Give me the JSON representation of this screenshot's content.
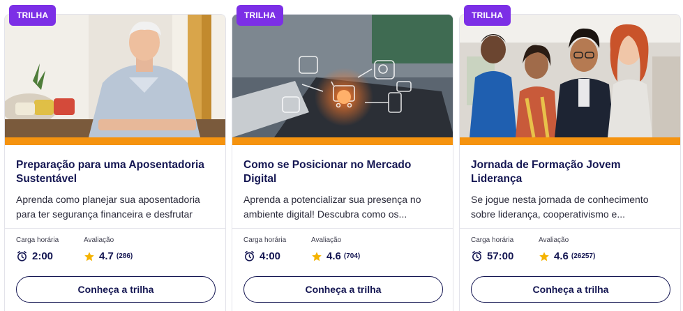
{
  "cards": [
    {
      "badge": "TRILHA",
      "title": "Preparação para uma Aposentadoria Sustentável",
      "description": "Aprenda como planejar sua aposentadoria para ter segurança financeira e desfrutar de...",
      "workload_label": "Carga horária",
      "workload": "2:00",
      "rating_label": "Avaliação",
      "rating": "4.7",
      "rating_count": "(286)",
      "cta": "Conheça a trilha"
    },
    {
      "badge": "TRILHA",
      "title": "Como se Posicionar no Mercado Digital",
      "description": "Aprenda a potencializar sua presença no ambiente digital! Descubra como os...",
      "workload_label": "Carga horária",
      "workload": "4:00",
      "rating_label": "Avaliação",
      "rating": "4.6",
      "rating_count": "(704)",
      "cta": "Conheça a trilha"
    },
    {
      "badge": "TRILHA",
      "title": "Jornada de Formação Jovem Liderança",
      "description": "Se jogue nesta jornada de conhecimento sobre liderança, cooperativismo e...",
      "workload_label": "Carga horária",
      "workload": "57:00",
      "rating_label": "Avaliação",
      "rating": "4.6",
      "rating_count": "(26257)",
      "cta": "Conheça a trilha"
    }
  ],
  "icons": {
    "workload": "alarm-clock-icon",
    "rating": "star-icon"
  },
  "colors": {
    "badge": "#7c2fe6",
    "accent_stripe": "#f5930f",
    "title": "#141652",
    "star": "#f5b301"
  }
}
